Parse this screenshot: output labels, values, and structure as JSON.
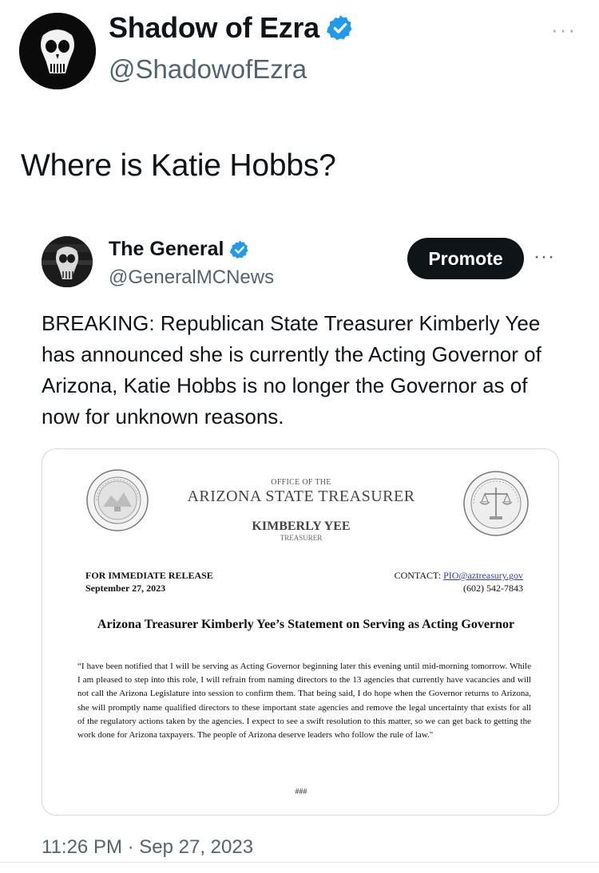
{
  "tweet": {
    "author_name": "Shadow of Ezra",
    "author_handle": "@ShadowofEzra",
    "more_label": "···",
    "text": "Where is Katie Hobbs?",
    "timestamp": "11:26 PM · Sep 27, 2023"
  },
  "quote": {
    "author_name": "The General",
    "author_handle": "@GeneralMCNews",
    "promote_label": "Promote",
    "more_label": "···",
    "text": "BREAKING: Republican State Treasurer Kimberly Yee has announced she is currently the Acting Governor of Arizona, Katie Hobbs is no longer the Governor as of now for unknown reasons."
  },
  "document": {
    "office_of": "OFFICE OF THE",
    "office_title": "ARIZONA STATE TREASURER",
    "treasurer_name": "KIMBERLY YEE",
    "treasurer_title": "TREASURER",
    "release_line1": "FOR IMMEDIATE RELEASE",
    "release_line2": "September 27, 2023",
    "contact_label": "CONTACT: ",
    "contact_email": "PIO@aztreasury.gov",
    "contact_phone": "(602) 542-7843",
    "headline": "Arizona Treasurer Kimberly Yee’s Statement on Serving as Acting Governor",
    "statement": "“I have been notified that I will be serving as Acting Governor beginning later this evening until mid-morning tomorrow. While I am pleased to step into this role, I will refrain from naming directors to the 13 agencies that currently have vacancies and will not call the Arizona Legislature into session to confirm them. That being said, I do hope when the Governor returns to Arizona, she will promptly name qualified directors to these important state agencies and remove the legal uncertainty that exists for all of the regulatory actions taken by the agencies. I expect to see a swift resolution to this matter, so we can get back to getting the work done for Arizona taxpayers. The people of Arizona deserve leaders who follow the rule of law.\"",
    "end_mark": "###"
  },
  "colors": {
    "verified_blue": "#1d9bf0",
    "text_primary": "#0f1419",
    "text_secondary": "#536471",
    "link": "#2b3fae"
  },
  "icons": {
    "verified": "verified-badge-icon",
    "more": "more-horizontal-icon",
    "avatar_main": "skull-avatar",
    "avatar_quote": "skull-avatar-dark"
  }
}
